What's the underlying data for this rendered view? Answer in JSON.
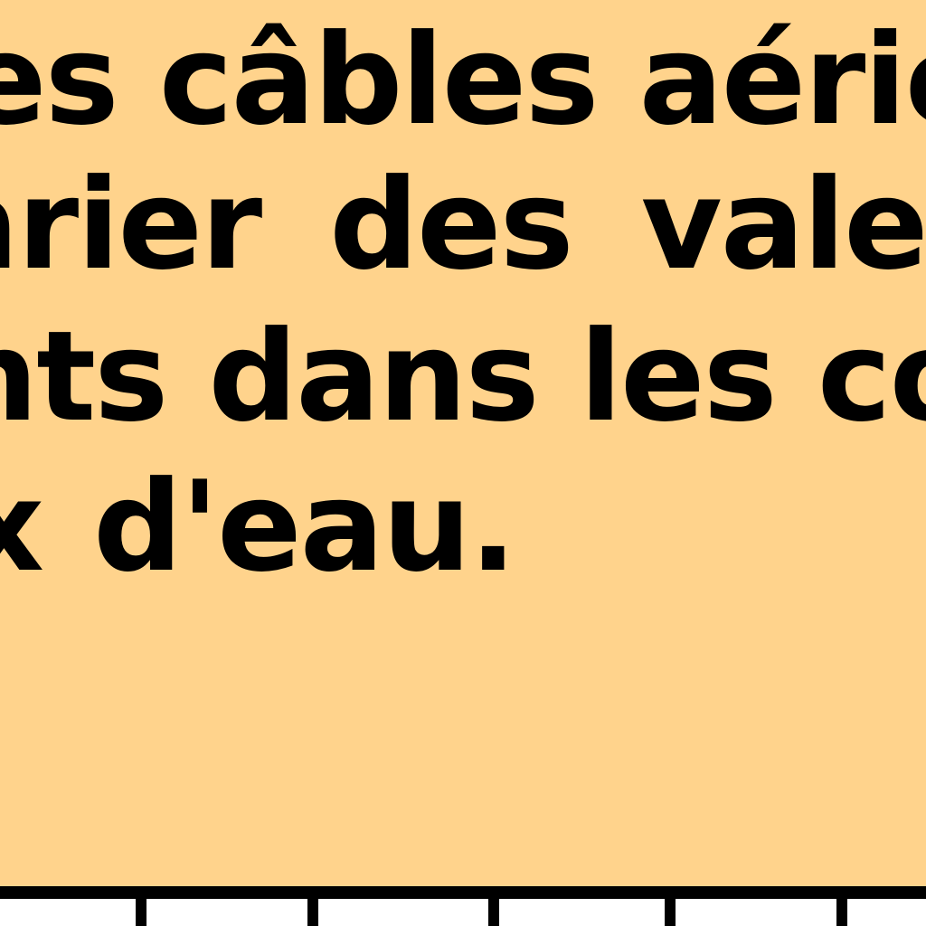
{
  "document": {
    "background_color": "#ffd38c",
    "text_color": "#000000",
    "lines": [
      "es câbles aériens",
      "arier  des  valeur",
      "nts dans les cond",
      "x d'eau."
    ]
  }
}
